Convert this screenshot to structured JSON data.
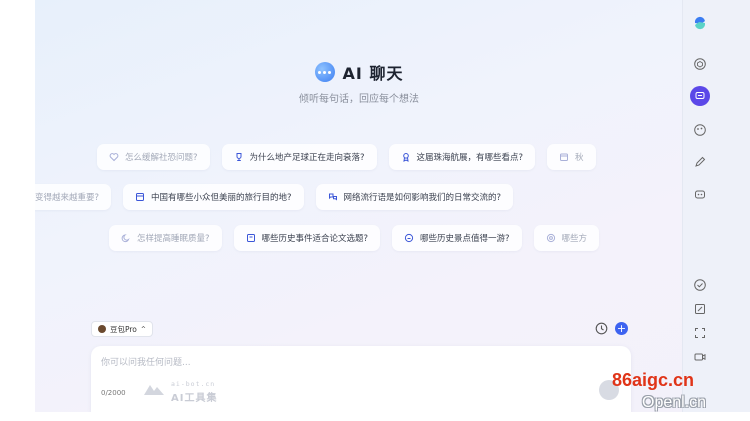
{
  "header": {
    "title": "AI 聊天",
    "subtitle": "倾听每句话，回应每个想法"
  },
  "suggestions": {
    "row1": [
      {
        "label": "怎么缓解社恐问题?",
        "icon": "heart-icon",
        "faded": true
      },
      {
        "label": "为什么地产足球正在走向衰落?",
        "icon": "trophy-icon",
        "faded": false
      },
      {
        "label": "这届珠海航展，有哪些看点?",
        "icon": "award-icon",
        "faded": false
      },
      {
        "label": "秋",
        "icon": "calendar-icon",
        "faded": true
      }
    ],
    "row2": [
      {
        "label": "变得越来越重要?",
        "icon": "",
        "faded": true
      },
      {
        "label": "中国有哪些小众但美丽的旅行目的地?",
        "icon": "map-icon",
        "faded": false
      },
      {
        "label": "网络流行语是如何影响我们的日常交流的?",
        "icon": "chat-bubbles-icon",
        "faded": false
      }
    ],
    "row3": [
      {
        "label": "怎样提高睡眠质量?",
        "icon": "moon-icon",
        "faded": true
      },
      {
        "label": "哪些历史事件适合论文选题?",
        "icon": "book-icon",
        "faded": false
      },
      {
        "label": "哪些历史景点值得一游?",
        "icon": "compass-icon",
        "faded": false
      },
      {
        "label": "哪些方",
        "icon": "target-icon",
        "faded": true
      }
    ]
  },
  "model": {
    "name": "豆包Pro",
    "chevron": "^"
  },
  "composer": {
    "placeholder": "你可以问我任何问题...",
    "counter": "0/2000",
    "new_chat_symbol": "+"
  },
  "watermarks": {
    "tool_domain": "ai-bot.cn",
    "tool_name": "AI工具集",
    "site_primary": "86aigc.cn",
    "site_secondary": "Openl.cn"
  },
  "sidebar": {
    "icons": [
      "logo-icon",
      "cube-icon",
      "chat-icon",
      "palette-icon",
      "pen-icon",
      "robot-icon",
      "check-circle-icon",
      "edit-box-icon",
      "scan-icon",
      "video-icon"
    ],
    "active": "chat-icon"
  },
  "colors": {
    "accent": "#5b48e8",
    "primary_button": "#3d63f0",
    "watermark_red": "#e03418"
  }
}
